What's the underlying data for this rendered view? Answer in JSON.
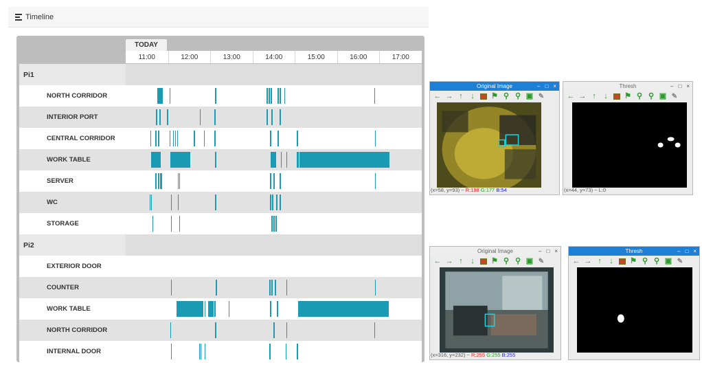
{
  "timeline": {
    "title": "Timeline",
    "today_tab": "TODAY",
    "hours": [
      "11:00",
      "12:00",
      "13:00",
      "14:00",
      "15:00",
      "16:00",
      "17:00"
    ],
    "accent_color": "#1a9bb3",
    "groups": [
      {
        "name": "Pi1",
        "rows": [
          {
            "label": "NORTH CORRIDOR",
            "events": [
              [
                "11:15",
                "11:16"
              ],
              [
                "11:17",
                "11:18"
              ],
              [
                "11:19",
                "11:20"
              ],
              [
                "11:21",
                "11:22"
              ],
              [
                "11:32",
                "11:33"
              ],
              [
                "12:37",
                "12:38"
              ],
              [
                "13:50",
                "13:51"
              ],
              [
                "13:53",
                "13:54"
              ],
              [
                "13:56",
                "13:57"
              ],
              [
                "14:06",
                "14:07"
              ],
              [
                "14:09",
                "14:10"
              ],
              [
                "14:15",
                "14:16"
              ],
              [
                "16:23",
                "16:25"
              ]
            ]
          },
          {
            "label": "INTERIOR PORT",
            "events": [
              [
                "11:13",
                "11:14"
              ],
              [
                "11:18",
                "11:19"
              ],
              [
                "11:29",
                "11:30"
              ],
              [
                "12:15",
                "12:16"
              ],
              [
                "12:36",
                "12:37"
              ],
              [
                "13:50",
                "13:51"
              ],
              [
                "13:57",
                "13:58"
              ],
              [
                "14:09",
                "14:10"
              ]
            ]
          },
          {
            "label": "CENTRAL CORRIDOR",
            "events": [
              [
                "11:05",
                "11:06"
              ],
              [
                "11:12",
                "11:13"
              ],
              [
                "11:16",
                "11:17"
              ],
              [
                "11:32",
                "11:34"
              ],
              [
                "11:37",
                "11:38"
              ],
              [
                "11:40",
                "11:41"
              ],
              [
                "11:43",
                "11:44"
              ],
              [
                "12:07",
                "12:08"
              ],
              [
                "12:21",
                "12:22"
              ],
              [
                "12:36",
                "12:37"
              ],
              [
                "13:55",
                "13:56"
              ],
              [
                "14:06",
                "14:07"
              ],
              [
                "14:33",
                "14:34"
              ],
              [
                "16:24",
                "16:25"
              ]
            ]
          },
          {
            "label": "WORK TABLE",
            "events": [
              [
                "11:06",
                "11:20"
              ],
              [
                "11:33",
                "12:02"
              ],
              [
                "12:37",
                "12:38"
              ],
              [
                "13:56",
                "14:04"
              ],
              [
                "14:10",
                "14:12"
              ],
              [
                "14:18",
                "14:20"
              ],
              [
                "14:33",
                "14:36"
              ],
              [
                "14:37",
                "16:45"
              ]
            ]
          },
          {
            "label": "SERVER",
            "events": [
              [
                "11:12",
                "11:13"
              ],
              [
                "11:16",
                "11:17"
              ],
              [
                "11:19",
                "11:20"
              ],
              [
                "11:20",
                "11:21"
              ],
              [
                "11:44",
                "11:45"
              ],
              [
                "11:46",
                "11:47"
              ],
              [
                "13:55",
                "13:56"
              ],
              [
                "14:00",
                "14:01"
              ],
              [
                "14:09",
                "14:10"
              ],
              [
                "16:24",
                "16:25"
              ]
            ]
          },
          {
            "label": "WC",
            "events": [
              [
                "11:04",
                "11:05"
              ],
              [
                "11:06",
                "11:07"
              ],
              [
                "11:34",
                "11:35"
              ],
              [
                "11:44",
                "11:45"
              ],
              [
                "12:37",
                "12:38"
              ],
              [
                "13:55",
                "13:56"
              ],
              [
                "13:58",
                "13:59"
              ],
              [
                "14:04",
                "14:06"
              ],
              [
                "14:09",
                "14:11"
              ]
            ]
          },
          {
            "label": "STORAGE",
            "events": [
              [
                "11:08",
                "11:09"
              ],
              [
                "11:34",
                "11:35"
              ],
              [
                "11:46",
                "11:47"
              ],
              [
                "13:57",
                "13:58"
              ],
              [
                "14:00",
                "14:01"
              ],
              [
                "14:03",
                "14:04"
              ]
            ]
          }
        ]
      },
      {
        "name": "Pi2",
        "rows": [
          {
            "label": "EXTERIOR DOOR",
            "events": []
          },
          {
            "label": "COUNTER",
            "events": [
              [
                "11:34",
                "11:35"
              ],
              [
                "12:38",
                "12:39"
              ],
              [
                "13:54",
                "13:55"
              ],
              [
                "13:57",
                "13:58"
              ],
              [
                "14:02",
                "14:03"
              ],
              [
                "14:18",
                "14:19"
              ],
              [
                "16:24",
                "16:26"
              ]
            ]
          },
          {
            "label": "WORK TABLE",
            "events": [
              [
                "11:42",
                "12:21"
              ],
              [
                "12:22",
                "12:24"
              ],
              [
                "12:27",
                "12:35"
              ],
              [
                "12:36",
                "12:38"
              ],
              [
                "12:56",
                "12:57"
              ],
              [
                "13:55",
                "13:56"
              ],
              [
                "14:05",
                "14:07"
              ],
              [
                "14:35",
                "16:44"
              ]
            ]
          },
          {
            "label": "NORTH CORRIDOR",
            "events": [
              [
                "11:33",
                "11:35"
              ],
              [
                "12:37",
                "12:38"
              ],
              [
                "14:00",
                "14:01"
              ],
              [
                "14:18",
                "14:19"
              ],
              [
                "16:23",
                "16:25"
              ]
            ]
          },
          {
            "label": "INTERNAL DOOR",
            "events": [
              [
                "11:34",
                "11:35"
              ],
              [
                "12:14",
                "12:15"
              ],
              [
                "12:16",
                "12:17"
              ],
              [
                "12:22",
                "12:24"
              ],
              [
                "13:54",
                "13:55"
              ],
              [
                "14:17",
                "14:18"
              ],
              [
                "14:33",
                "14:34"
              ]
            ]
          }
        ]
      }
    ]
  },
  "viewers": [
    {
      "title": "Original Image",
      "title_style": "active",
      "status": {
        "coords": "(x=58, y=93) ~",
        "r": "R:198",
        "g": "G:177",
        "b": "B:54"
      },
      "image": "room-overhead-color"
    },
    {
      "title": "Thresh",
      "title_style": "inactive",
      "status": {
        "coords": "(x=44, y=73) ~",
        "r": "",
        "g": "",
        "b": "",
        "value": "L:0"
      },
      "image": "threshold-mask"
    },
    {
      "title": "Original Image",
      "title_style": "inactive",
      "status": {
        "coords": "(x=316, y=232) ~",
        "r": "R:255",
        "g": "G:255",
        "b": "B:255"
      },
      "image": "room-wideangle-color"
    },
    {
      "title": "Thresh",
      "title_style": "active",
      "status": {
        "coords": "",
        "r": "",
        "g": "",
        "b": ""
      },
      "image": "threshold-mask"
    }
  ],
  "toolbar_icons": [
    "arrow-left-icon",
    "arrow-right-icon",
    "arrow-up-icon",
    "arrow-down-icon",
    "save-image-icon",
    "flag-icon",
    "zoom-in-icon",
    "zoom-out-icon",
    "disk-icon",
    "brush-icon"
  ],
  "window_controls": {
    "minimize": "–",
    "maximize": "□",
    "close": "×"
  }
}
